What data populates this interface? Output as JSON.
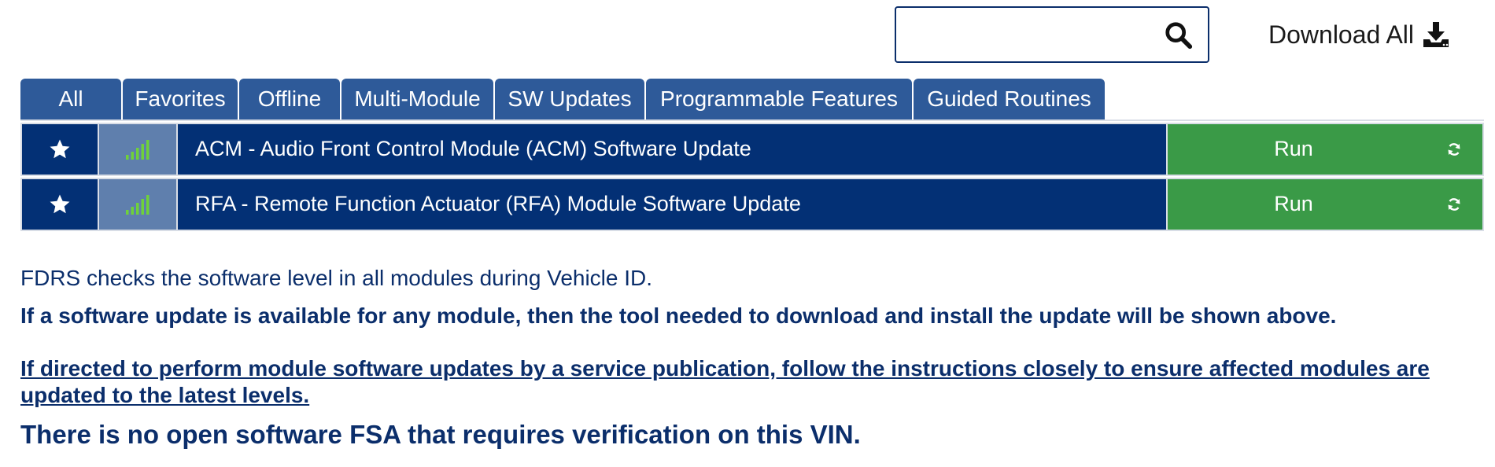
{
  "search": {
    "value": "",
    "placeholder": ""
  },
  "toolbar": {
    "download_all_label": "Download All"
  },
  "tabs": [
    {
      "label": "All"
    },
    {
      "label": "Favorites"
    },
    {
      "label": "Offline"
    },
    {
      "label": "Multi-Module"
    },
    {
      "label": "SW Updates"
    },
    {
      "label": "Programmable Features"
    },
    {
      "label": "Guided Routines"
    }
  ],
  "routines": [
    {
      "title": "ACM - Audio Front Control Module (ACM) Software Update",
      "action": "Run",
      "favorite_icon": "star-icon",
      "signal_icon": "signal-bars-icon",
      "action_icon": "refresh-icon"
    },
    {
      "title": "RFA - Remote Function Actuator (RFA) Module Software Update",
      "action": "Run",
      "favorite_icon": "star-icon",
      "signal_icon": "signal-bars-icon",
      "action_icon": "refresh-icon"
    }
  ],
  "info": {
    "line1": "FDRS checks the software level in all modules during Vehicle ID.",
    "line2": "If a software update is available for any module, then the tool needed to download and install the update will be shown above.",
    "line3": "If directed to perform module software updates by a service publication, follow the instructions closely to ensure affected modules are updated to the latest levels.",
    "line4": "There is no open software FSA that requires verification on this VIN."
  },
  "colors": {
    "primary": "#033075",
    "tab": "#2e5a99",
    "signal_cell": "#5f7fad",
    "run": "#3a9a47",
    "text": "#0b2e6b",
    "signal_green": "#6fd13a"
  }
}
